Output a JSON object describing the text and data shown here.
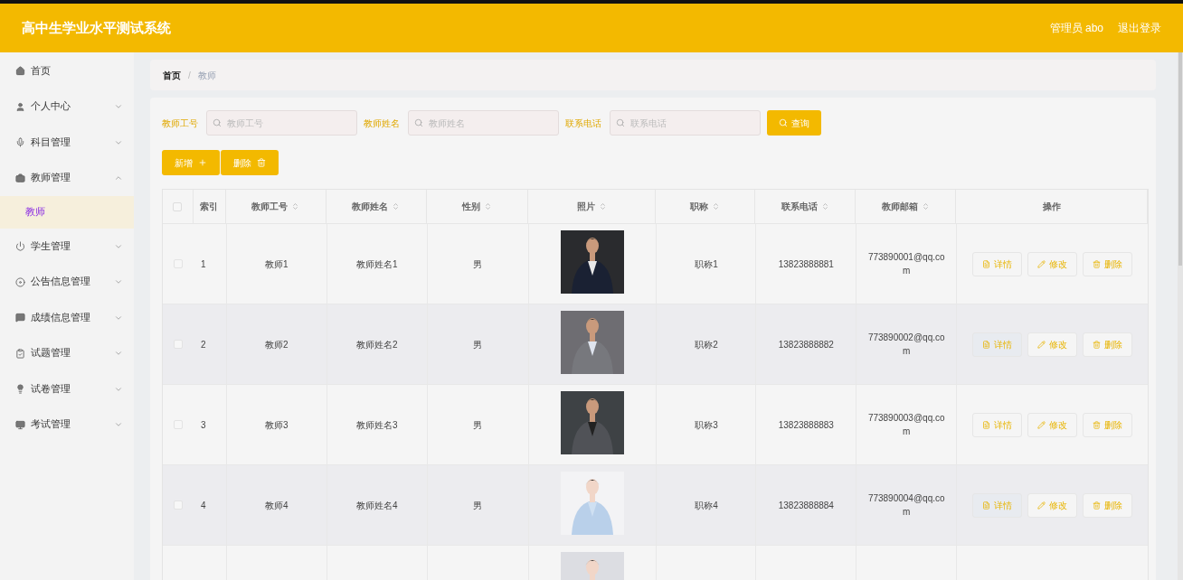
{
  "header": {
    "title": "高中生学业水平测试系统",
    "user": "管理员 abo",
    "logout": "退出登录"
  },
  "sidebar": {
    "items": [
      {
        "label": "首页"
      },
      {
        "label": "个人中心",
        "expandable": true,
        "expanded": false
      },
      {
        "label": "科目管理",
        "expandable": true,
        "expanded": false
      },
      {
        "label": "教师管理",
        "expandable": true,
        "expanded": true,
        "children": [
          {
            "label": "教师",
            "selected": true
          }
        ]
      },
      {
        "label": "学生管理",
        "expandable": true,
        "expanded": false
      },
      {
        "label": "公告信息管理",
        "expandable": true,
        "expanded": false
      },
      {
        "label": "成绩信息管理",
        "expandable": true,
        "expanded": false
      },
      {
        "label": "试题管理",
        "expandable": true,
        "expanded": false
      },
      {
        "label": "试卷管理",
        "expandable": true,
        "expanded": false
      },
      {
        "label": "考试管理",
        "expandable": true,
        "expanded": false
      }
    ]
  },
  "breadcrumb": [
    {
      "label": "首页",
      "current": false
    },
    {
      "label": "教师",
      "current": true
    }
  ],
  "breadcrumb_separator": "/",
  "search": {
    "fields": [
      {
        "label": "教师工号",
        "placeholder": "教师工号"
      },
      {
        "label": "教师姓名",
        "placeholder": "教师姓名"
      },
      {
        "label": "联系电话",
        "placeholder": "联系电话"
      }
    ],
    "button": "查询"
  },
  "actions": [
    "新增",
    "删除"
  ],
  "table": {
    "all_checked": false,
    "columns": [
      {
        "label": "索引",
        "sortable": false
      },
      {
        "label": "教师工号",
        "sortable": true
      },
      {
        "label": "教师姓名",
        "sortable": true
      },
      {
        "label": "性别",
        "sortable": true
      },
      {
        "label": "照片",
        "sortable": true
      },
      {
        "label": "职称",
        "sortable": true
      },
      {
        "label": "联系电话",
        "sortable": true
      },
      {
        "label": "教师邮箱",
        "sortable": true
      },
      {
        "label": "操作",
        "sortable": false
      }
    ],
    "rows": [
      {
        "checked": false,
        "index": "1",
        "id": "教师1",
        "name": "教师姓名1",
        "gender": "男",
        "photo": {
          "kind": "picture"
        },
        "title": "职称1",
        "phone": "13823888881",
        "email": "773890001@qq.com",
        "buttons": [
          "详情",
          "修改",
          "删除"
        ]
      },
      {
        "checked": false,
        "index": "2",
        "id": "教师2",
        "name": "教师姓名2",
        "gender": "男",
        "photo": {
          "kind": "picture"
        },
        "title": "职称2",
        "phone": "13823888882",
        "email": "773890002@qq.com",
        "buttons": [
          "详情",
          "修改",
          "删除"
        ]
      },
      {
        "checked": false,
        "index": "3",
        "id": "教师3",
        "name": "教师姓名3",
        "gender": "男",
        "photo": {
          "kind": "picture"
        },
        "title": "职称3",
        "phone": "13823888883",
        "email": "773890003@qq.com",
        "buttons": [
          "详情",
          "修改",
          "删除"
        ]
      },
      {
        "checked": false,
        "index": "4",
        "id": "教师4",
        "name": "教师姓名4",
        "gender": "男",
        "photo": {
          "kind": "picture"
        },
        "title": "职称4",
        "phone": "13823888884",
        "email": "773890004@qq.com",
        "buttons": [
          "详情",
          "修改",
          "删除"
        ]
      },
      {
        "photo": {
          "kind": "picture"
        }
      }
    ]
  }
}
